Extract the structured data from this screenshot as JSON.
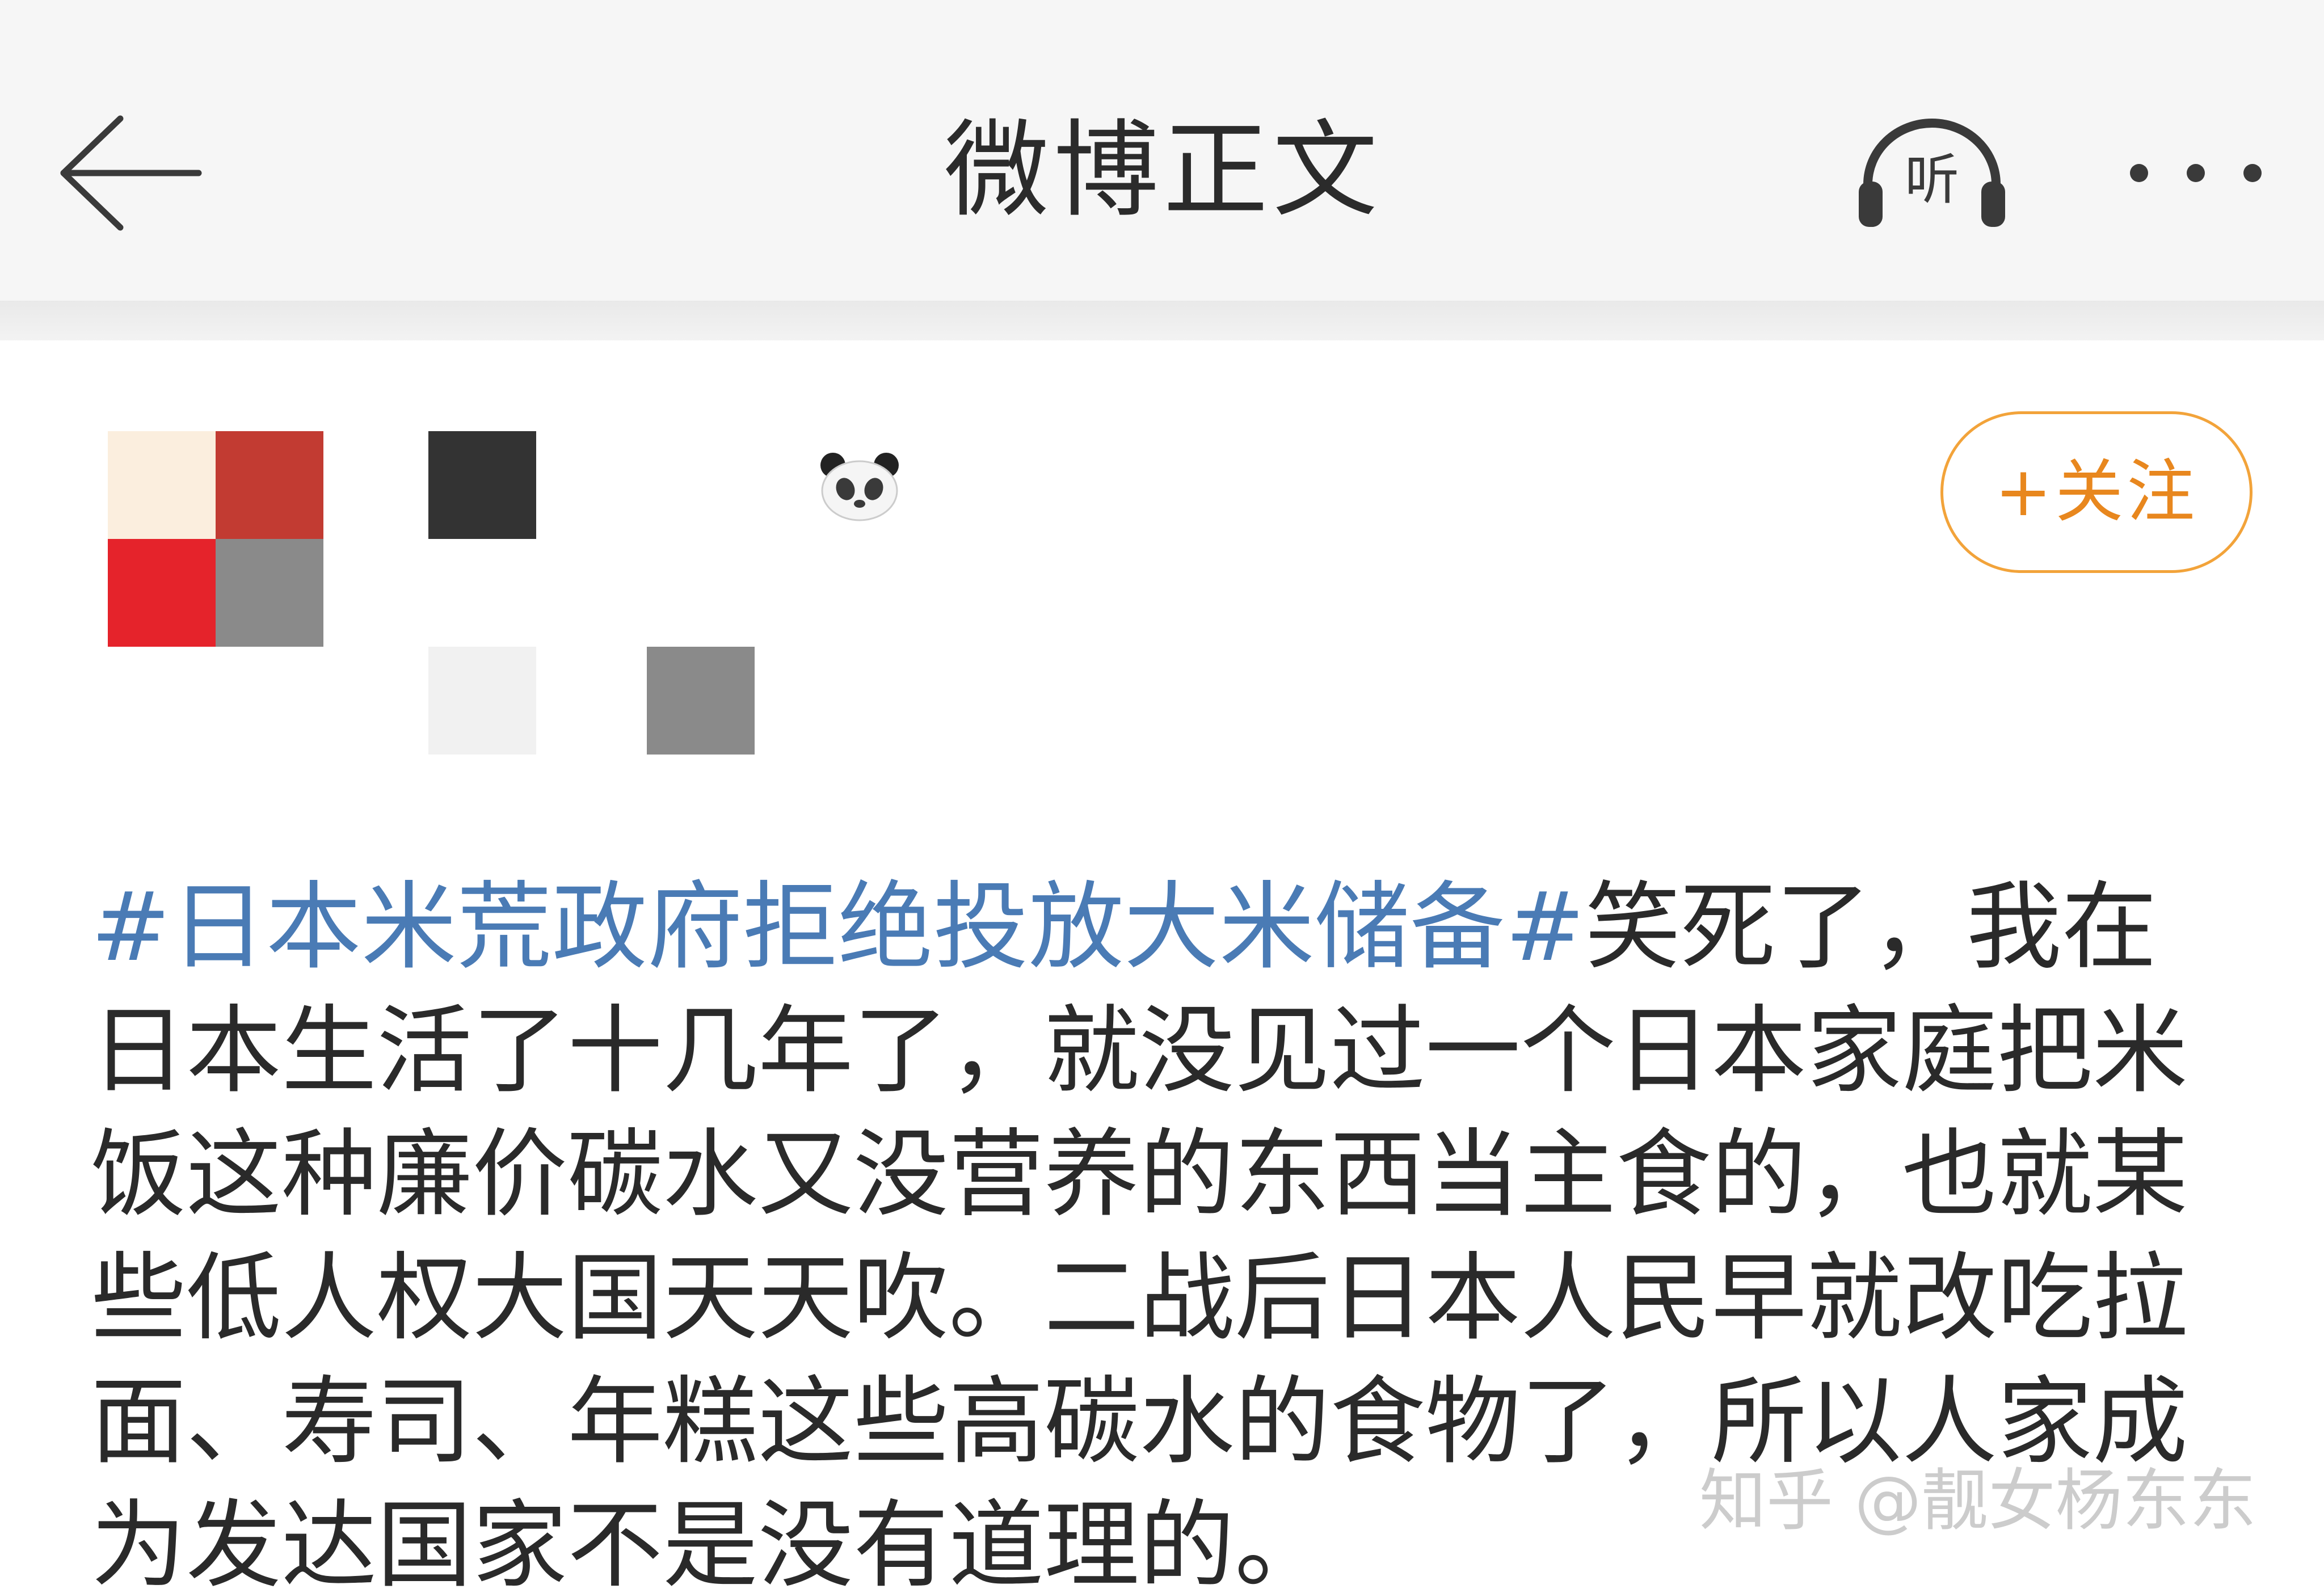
{
  "nav": {
    "title": "微博正文",
    "listen_label": "听",
    "icons": [
      "back-arrow-icon",
      "headphones-listen-icon",
      "more-dots-icon"
    ]
  },
  "author": {
    "follow_label": "+关注",
    "emoji": "panda-emoji"
  },
  "post": {
    "topic": "#日本米荒政府拒绝投放大米储备#",
    "text": "笑死了，我在\n日本生活了十几年了，就没见过一个日本家庭把米\n饭这种廉价碳水又没营养的东西当主食的，也就某\n些低人权大国天天吹。二战后日本人民早就改吃拉\n面、寿司、年糕这些高碳水的食物了，所以人家成\n为发达国家不是没有道理的。"
  },
  "watermark": {
    "text": "知乎 @靓女杨东东"
  },
  "colors": {
    "topic_link": "#4a7bb5",
    "follow_accent": "#e8871e",
    "follow_border": "#f2a33a",
    "nav_background": "#f6f6f6"
  }
}
